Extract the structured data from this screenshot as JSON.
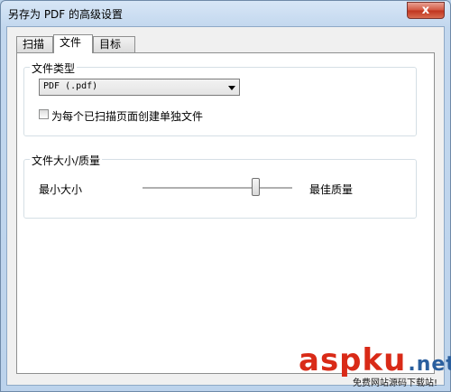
{
  "window": {
    "title": "另存为 PDF 的高级设置",
    "close_label": "x"
  },
  "tabs": [
    {
      "label": "扫描",
      "active": false
    },
    {
      "label": "文件",
      "active": true
    },
    {
      "label": "目标",
      "active": false
    }
  ],
  "file_type": {
    "legend": "文件类型",
    "selected": "PDF (.pdf)",
    "checkbox_label": "为每个已扫描页面创建单独文件",
    "checkbox_checked": false
  },
  "size_quality": {
    "legend": "文件大小/质量",
    "min_label": "最小大小",
    "max_label": "最佳质量",
    "slider_value": 0.75
  },
  "watermark": {
    "text": "aspku",
    "tld": ".net",
    "sub": "免费网站源码下载站!"
  }
}
